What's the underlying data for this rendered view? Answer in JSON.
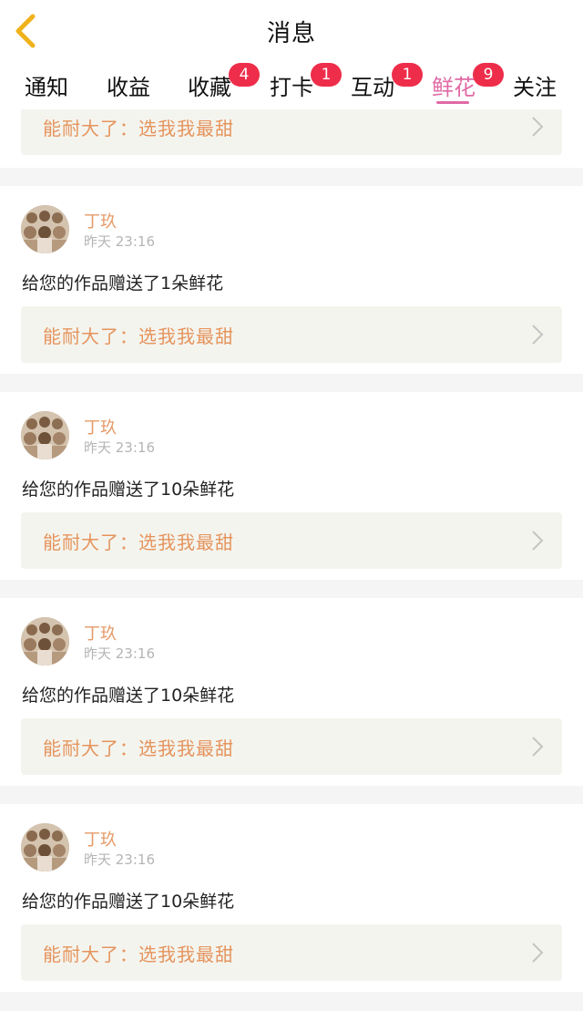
{
  "header": {
    "title": "消息",
    "back_icon": "chevron-left-icon",
    "back_color": "#f0b21c"
  },
  "tabs": [
    {
      "label": "通知"
    },
    {
      "label": "收益"
    },
    {
      "label": "收藏",
      "badge": "4"
    },
    {
      "label": "打卡",
      "badge": "1"
    },
    {
      "label": "互动",
      "badge": "1"
    },
    {
      "label": "鲜花",
      "badge": "9",
      "active": true
    },
    {
      "label": "关注"
    }
  ],
  "colors": {
    "active_tab": "#e06aa4",
    "badge": "#ee2d4a",
    "username": "#e59a68",
    "work_title": "#e5945d"
  },
  "feed": {
    "partial_top": {
      "work_title": "能耐大了：选我我最甜"
    },
    "items": [
      {
        "user": "丁玖",
        "time": "昨天 23:16",
        "message": "给您的作品赠送了1朵鲜花",
        "work_title": "能耐大了：选我我最甜"
      },
      {
        "user": "丁玖",
        "time": "昨天 23:16",
        "message": "给您的作品赠送了10朵鲜花",
        "work_title": "能耐大了：选我我最甜"
      },
      {
        "user": "丁玖",
        "time": "昨天 23:16",
        "message": "给您的作品赠送了10朵鲜花",
        "work_title": "能耐大了：选我我最甜"
      },
      {
        "user": "丁玖",
        "time": "昨天 23:16",
        "message": "给您的作品赠送了10朵鲜花",
        "work_title": "能耐大了：选我我最甜"
      }
    ]
  }
}
